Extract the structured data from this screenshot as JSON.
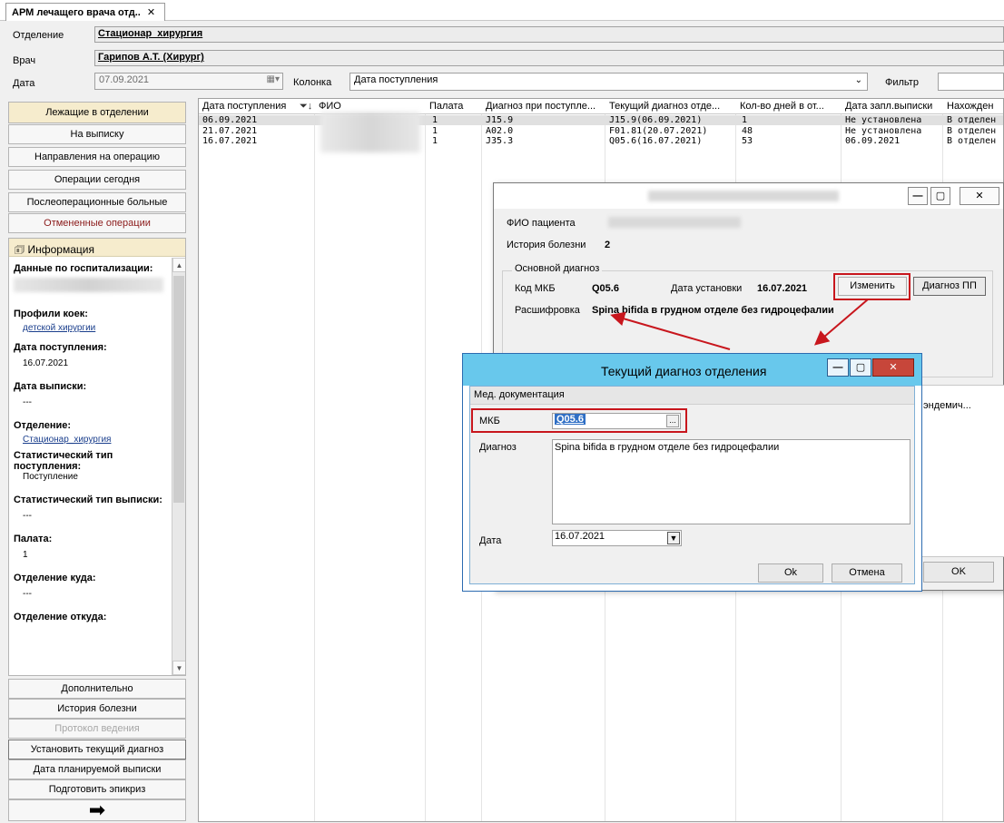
{
  "tab": {
    "title": "АРМ лечащего врача отд..",
    "close": "✕"
  },
  "header": {
    "department_label": "Отделение",
    "department_value": "Стационар_хирургия",
    "doctor_label": "Врач",
    "doctor_value": "Гарипов А.Т. (Хирург)",
    "date_label": "Дата",
    "date_value": "07.09.2021",
    "column_label": "Колонка",
    "column_value": "Дата поступления",
    "filter_label": "Фильтр",
    "filter_value": ""
  },
  "nav": {
    "items": [
      "Лежащие в отделении",
      "На выписку",
      "Направления на операцию",
      "Операции сегодня",
      "Послеоперационные больные",
      "Отмененные операции"
    ],
    "bottom": [
      "Дополнительно",
      "История болезни",
      "Протокол ведения",
      "Установить текущий диагноз",
      "Дата планируемой выписки",
      "Подготовить эпикриз"
    ],
    "arrow": "➡"
  },
  "info": {
    "title": "Информация",
    "hosp_label": "Данные по госпитализации:",
    "profiles_label": "Профили коек:",
    "profiles_value": "детской хирургии",
    "admission_label": "Дата поступления:",
    "admission_value": "16.07.2021",
    "discharge_label": "Дата выписки:",
    "discharge_value": "---",
    "dept_label": "Отделение:",
    "dept_value": "Стационар_хирургия",
    "stat_in_label": "Статистический тип поступления:",
    "stat_in_value": "Поступление",
    "stat_out_label": "Статистический тип выписки:",
    "stat_out_value": "---",
    "ward_label": "Палата:",
    "ward_value": "1",
    "to_label": "Отделение куда:",
    "to_value": "---",
    "from_label": "Отделение откуда:"
  },
  "grid": {
    "columns": [
      "Дата поступления",
      "ФИО",
      "Палата",
      "Диагноз при поступле...",
      "Текущий диагноз отде...",
      "Кол-во дней в от...",
      "Дата запл.выписки",
      "Нахожден"
    ],
    "rows": [
      [
        "06.09.2021",
        "",
        "1",
        "J15.9",
        "J15.9(06.09.2021)",
        "1",
        "Не установлена",
        "В отделен"
      ],
      [
        "21.07.2021",
        "",
        "1",
        "A02.0",
        "F01.81(20.07.2021)",
        "48",
        "Не установлена",
        "В отделен"
      ],
      [
        "16.07.2021",
        "",
        "1",
        "J35.3",
        "Q05.6(16.07.2021)",
        "53",
        "06.09.2021",
        "В отделен"
      ]
    ]
  },
  "patient_window": {
    "fio_label": "ФИО пациента",
    "history_label": "История болезни",
    "history_value": "2",
    "group_label": "Основной диагноз",
    "mkb_label": "Код МКБ",
    "mkb_value": "Q05.6",
    "date_label": "Дата установки",
    "date_value": "16.07.2021",
    "change_button": "Изменить",
    "pp_button": "Диагноз ПП",
    "decode_label": "Расшифровка",
    "decode_value": "Spina bifida в грудном отделе без гидроцефалии",
    "col_fragment": "эндемич...",
    "ok_button": "OK",
    "min": "—",
    "max": "▢",
    "close": "✕"
  },
  "dialog": {
    "title": "Текущий диагноз отделения",
    "section": "Мед. документация",
    "mkb_label": "МКБ",
    "mkb_value": "Q05.6",
    "diag_label": "Диагноз",
    "diag_value": "Spina bifida в грудном отделе без гидроцефалии",
    "date_label": "Дата",
    "date_value": "16.07.2021",
    "ok_button": "Ok",
    "cancel_button": "Отмена",
    "ellipsis": "...",
    "min": "—",
    "max": "▢",
    "close": "✕"
  },
  "colors": {
    "accent_red": "#c8161d",
    "dialog_title": "#68c8ec",
    "nav_active": "#f6eccd"
  }
}
